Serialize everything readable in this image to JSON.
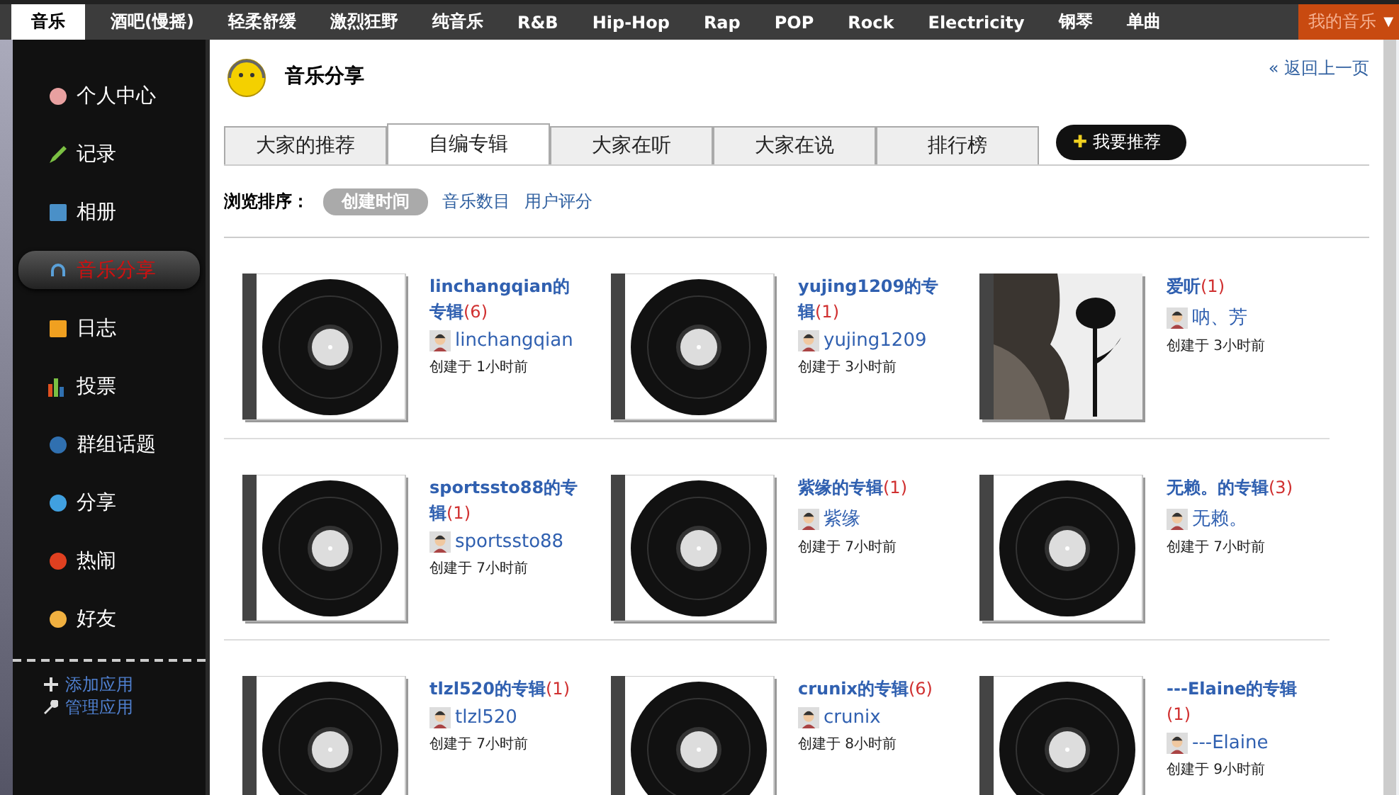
{
  "top_nav": {
    "items": [
      {
        "label": "音乐",
        "selected": true
      },
      {
        "label": "酒吧(慢摇)",
        "selected": false
      },
      {
        "label": "轻柔舒缓",
        "selected": false
      },
      {
        "label": "激烈狂野",
        "selected": false
      },
      {
        "label": "纯音乐",
        "selected": false
      },
      {
        "label": "R&B",
        "selected": false
      },
      {
        "label": "Hip-Hop",
        "selected": false
      },
      {
        "label": "Rap",
        "selected": false
      },
      {
        "label": "POP",
        "selected": false
      },
      {
        "label": "Rock",
        "selected": false
      },
      {
        "label": "Electricity",
        "selected": false
      },
      {
        "label": "钢琴",
        "selected": false
      },
      {
        "label": "单曲",
        "selected": false
      }
    ],
    "my_music": {
      "label": "我的音乐",
      "caret": "▼"
    }
  },
  "sidebar": {
    "items": [
      {
        "label": "个人中心",
        "selected": false
      },
      {
        "label": "记录",
        "selected": false
      },
      {
        "label": "相册",
        "selected": false
      },
      {
        "label": "音乐分享",
        "selected": true
      },
      {
        "label": "日志",
        "selected": false
      },
      {
        "label": "投票",
        "selected": false
      },
      {
        "label": "群组话题",
        "selected": false
      },
      {
        "label": "分享",
        "selected": false
      },
      {
        "label": "热闹",
        "selected": false
      },
      {
        "label": "好友",
        "selected": false
      }
    ],
    "actions": [
      {
        "label": "添加应用",
        "kind": "add"
      },
      {
        "label": "管理应用",
        "kind": "manage"
      }
    ]
  },
  "page": {
    "title": "音乐分享",
    "back_link": "« 返回上一页"
  },
  "tabs": [
    {
      "label": "大家的推荐",
      "selected": false
    },
    {
      "label": "自编专辑",
      "selected": true
    },
    {
      "label": "大家在听",
      "selected": false
    },
    {
      "label": "大家在说",
      "selected": false
    },
    {
      "label": "排行榜",
      "selected": false
    }
  ],
  "recommend_button": {
    "icon": "✚",
    "label": "我要推荐"
  },
  "sort": {
    "label": "浏览排序：",
    "options": [
      {
        "label": "创建时间",
        "selected": true
      },
      {
        "label": "音乐数目",
        "selected": false
      },
      {
        "label": "用户评分",
        "selected": false
      }
    ]
  },
  "albums": [
    {
      "title": "linchangqian的专辑",
      "count": "(6)",
      "owner": "linchangqian",
      "created": "创建于 1小时前",
      "kind": "vinyl"
    },
    {
      "title": "yujing1209的专辑",
      "count": "(1)",
      "owner": "yujing1209",
      "created": "创建于 3小时前",
      "kind": "vinyl"
    },
    {
      "title": "爱听",
      "count": "(1)",
      "owner": "呐、芳",
      "created": "创建于 3小时前",
      "kind": "picture"
    },
    {
      "title": "sportssto88的专辑",
      "count": "(1)",
      "owner": "sportssto88",
      "created": "创建于 7小时前",
      "kind": "vinyl"
    },
    {
      "title": "紫缘的专辑",
      "count": "(1)",
      "owner": "紫缘",
      "created": "创建于 7小时前",
      "kind": "vinyl"
    },
    {
      "title": "无赖。的专辑",
      "count": "(3)",
      "owner": "无赖。",
      "created": "创建于 7小时前",
      "kind": "vinyl"
    },
    {
      "title": "tlzl520的专辑",
      "count": "(1)",
      "owner": "tlzl520",
      "created": "创建于 7小时前",
      "kind": "vinyl"
    },
    {
      "title": "crunix的专辑",
      "count": "(6)",
      "owner": "crunix",
      "created": "创建于 8小时前",
      "kind": "vinyl"
    },
    {
      "title": "---Elaine的专辑",
      "count": "(1)",
      "owner": "---Elaine",
      "created": "创建于 9小时前",
      "kind": "vinyl"
    }
  ]
}
